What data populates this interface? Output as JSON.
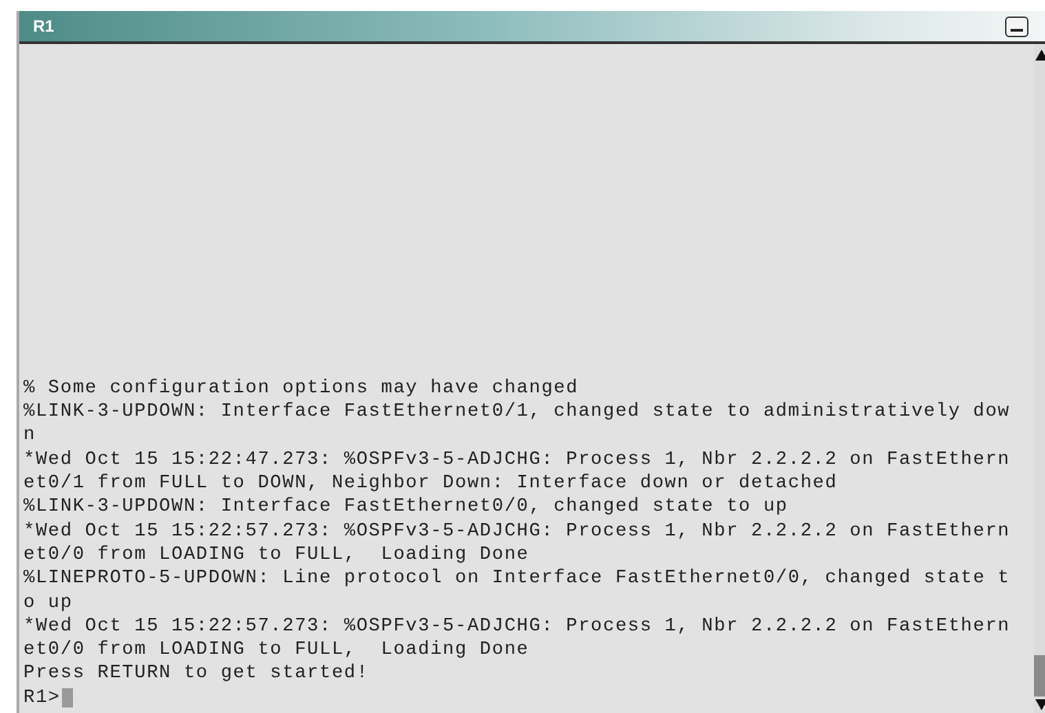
{
  "window": {
    "title": "R1"
  },
  "terminal": {
    "lines": [
      "% Some configuration options may have changed",
      "%LINK-3-UPDOWN: Interface FastEthernet0/1, changed state to administratively dow",
      "n",
      "*Wed Oct 15 15:22:47.273: %OSPFv3-5-ADJCHG: Process 1, Nbr 2.2.2.2 on FastEthern",
      "et0/1 from FULL to DOWN, Neighbor Down: Interface down or detached",
      "%LINK-3-UPDOWN: Interface FastEthernet0/0, changed state to up",
      "*Wed Oct 15 15:22:57.273: %OSPFv3-5-ADJCHG: Process 1, Nbr 2.2.2.2 on FastEthern",
      "et0/0 from LOADING to FULL,  Loading Done",
      "%LINEPROTO-5-UPDOWN: Line protocol on Interface FastEthernet0/0, changed state t",
      "o up",
      "*Wed Oct 15 15:22:57.273: %OSPFv3-5-ADJCHG: Process 1, Nbr 2.2.2.2 on FastEthern",
      "et0/0 from LOADING to FULL,  Loading Done",
      "Press RETURN to get started!"
    ],
    "prompt": "R1>"
  }
}
